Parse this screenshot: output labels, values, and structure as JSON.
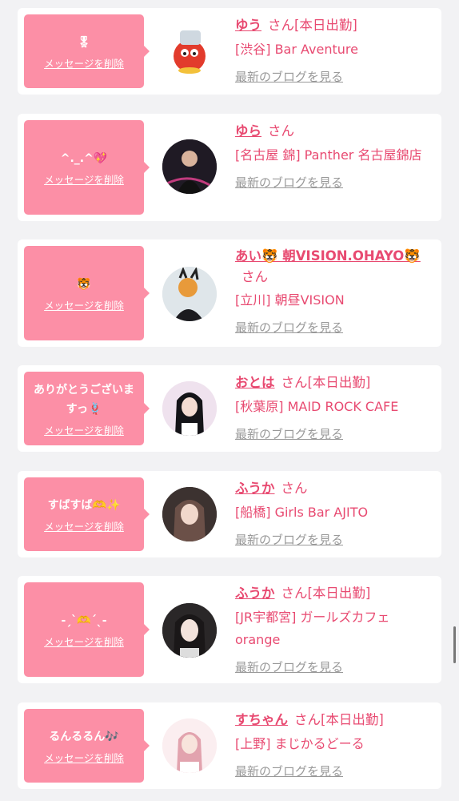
{
  "delete_label": "メッセージを削除",
  "blog_label": "最新のブログを見る",
  "san": "さん",
  "cards": [
    {
      "message": "🎖",
      "name": "ゆう",
      "work_tag": "[本日出勤]",
      "shop": "[渋谷] Bar Aventure"
    },
    {
      "message": "^._.^💖",
      "name": "ゆら",
      "work_tag": "",
      "shop": "[名古屋 錦] Panther 名古屋錦店"
    },
    {
      "message": "🐯",
      "name": "あい🐯 朝VISION.OHAYO🐯",
      "work_tag": "",
      "shop": "[立川] 朝昼VISION"
    },
    {
      "message": "ありがとうございますっ🪢",
      "name": "おとは",
      "work_tag": "[本日出勤]",
      "shop": "[秋葉原] MAID ROCK CAFE"
    },
    {
      "message": "すばすば🫶✨",
      "name": "ふうか",
      "work_tag": "",
      "shop": "[船橋] Girls Bar AJITO"
    },
    {
      "message": "-ˏˋ🫶ˊˎ-",
      "name": "ふうか",
      "work_tag": "[本日出勤]",
      "shop": "[JR宇都宮] ガールズカフェorange"
    },
    {
      "message": "るんるるん🎶",
      "name": "すちゃん",
      "work_tag": "[本日出勤]",
      "shop": "[上野] まじかるどーる"
    }
  ],
  "icons": {
    "scrollbar": "scrollbar-thumb"
  }
}
